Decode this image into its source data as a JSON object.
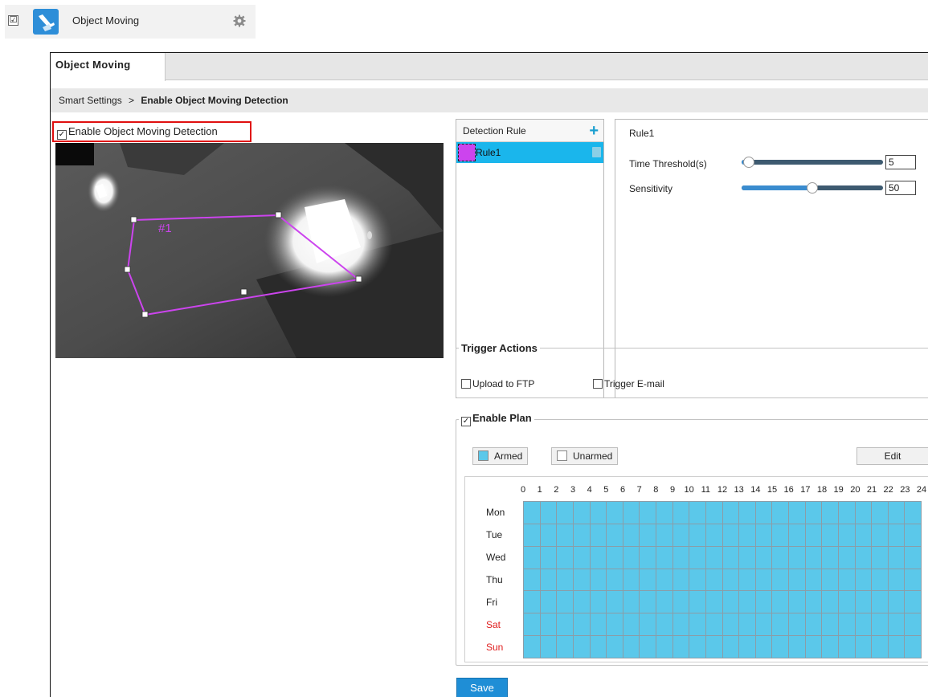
{
  "feature": {
    "enabled": true,
    "check_mark": "☑",
    "label": "Object Moving",
    "icon": "object-moving-icon",
    "settings_icon": "gear-icon"
  },
  "tab": {
    "label": "Object Moving"
  },
  "breadcrumb": {
    "parent": "Smart Settings",
    "separator": ">",
    "current": "Enable Object Moving Detection"
  },
  "enable_detection": {
    "checked": true,
    "check_mark": "✓",
    "label": "Enable Object Moving Detection"
  },
  "video": {
    "region_label": "#1",
    "region_color": "#cc44ee"
  },
  "detection_rules": {
    "header": "Detection Rule",
    "add_icon": "plus-icon",
    "items": [
      {
        "name": "Rule1",
        "color": "#cc44ee",
        "selected": true
      }
    ]
  },
  "rule_settings": {
    "name": "Rule1",
    "time_threshold": {
      "label": "Time Threshold(s)",
      "value": "5",
      "min": 0,
      "max": 100
    },
    "sensitivity": {
      "label": "Sensitivity",
      "value": "50",
      "min": 0,
      "max": 100
    }
  },
  "trigger_actions": {
    "legend": "Trigger Actions",
    "options": [
      {
        "label": "Upload to FTP",
        "checked": false
      },
      {
        "label": "Trigger E-mail",
        "checked": false
      }
    ]
  },
  "plan": {
    "legend": "Enable Plan",
    "enabled": true,
    "check_mark": "✓",
    "armed_label": "Armed",
    "armed_color": "#5bc8ea",
    "unarmed_label": "Unarmed",
    "edit_label": "Edit",
    "hours": [
      "0",
      "1",
      "2",
      "3",
      "4",
      "5",
      "6",
      "7",
      "8",
      "9",
      "10",
      "11",
      "12",
      "13",
      "14",
      "15",
      "16",
      "17",
      "18",
      "19",
      "20",
      "21",
      "22",
      "23",
      "24"
    ],
    "days": [
      {
        "label": "Mon",
        "color": "#222222"
      },
      {
        "label": "Tue",
        "color": "#222222"
      },
      {
        "label": "Wed",
        "color": "#222222"
      },
      {
        "label": "Thu",
        "color": "#222222"
      },
      {
        "label": "Fri",
        "color": "#222222"
      },
      {
        "label": "Sat",
        "color": "#e02020"
      },
      {
        "label": "Sun",
        "color": "#e02020"
      }
    ],
    "all_armed": true
  },
  "save_label": "Save"
}
